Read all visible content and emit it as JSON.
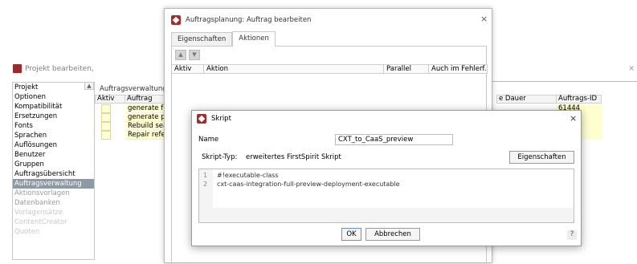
{
  "background_window": {
    "title": "Projekt bearbeiten,",
    "close_glyph": "×",
    "sidebar_items": [
      {
        "label": "Projekt",
        "active": false
      },
      {
        "label": "Optionen",
        "active": false
      },
      {
        "label": "Kompatibilität",
        "active": false
      },
      {
        "label": "Ersetzungen",
        "active": false
      },
      {
        "label": "Fonts",
        "active": false
      },
      {
        "label": "Sprachen",
        "active": false
      },
      {
        "label": "Auflösungen",
        "active": false
      },
      {
        "label": "Benutzer",
        "active": false
      },
      {
        "label": "Gruppen",
        "active": false
      },
      {
        "label": "Auftragsübersicht",
        "active": false
      },
      {
        "label": "Auftragsverwaltung",
        "active": true
      },
      {
        "label": "Aktionsvorlagen",
        "active": false
      },
      {
        "label": "Datenbanken",
        "active": false
      },
      {
        "label": "Vorlagensätze",
        "active": false
      },
      {
        "label": "ContentCreator",
        "active": false
      },
      {
        "label": "Quoten",
        "active": false
      }
    ],
    "panel_title": "Auftragsverwaltung",
    "table_headers": {
      "aktiv": "Aktiv",
      "auftrag": "Auftrag"
    },
    "table_rows": [
      "generate full",
      "generate pa",
      "Rebuild sea",
      "Repair refer"
    ],
    "right_headers": {
      "dauer": "e Dauer",
      "id": "Auftrags-ID"
    },
    "right_ids": [
      "61444",
      "",
      "",
      ""
    ]
  },
  "plan_dialog": {
    "title": "Auftragsplanung: Auftrag bearbeiten",
    "close_glyph": "×",
    "tabs": [
      {
        "label": "Eigenschaften",
        "active": false
      },
      {
        "label": "Aktionen",
        "active": true
      }
    ],
    "actions_header": {
      "aktiv": "Aktiv",
      "aktion": "Aktion",
      "parallel": "Parallel",
      "auch_im_fehlerfall": "Auch im Fehlerf..."
    }
  },
  "script_dialog": {
    "title": "Skript",
    "close_glyph": "×",
    "name_label": "Name",
    "name_value": "CXT_to_CaaS_preview",
    "type_label": "Skript-Typ:",
    "type_value": "erweitertes FirstSpirit Skript",
    "properties_button": "Eigenschaften",
    "code_lines": [
      {
        "n": "1",
        "text": "#!executable-class"
      },
      {
        "n": "2",
        "text": "cxt-caas-integration-full-preview-deployment-executable"
      }
    ],
    "ok_button": "OK",
    "cancel_button": "Abbrechen",
    "help_glyph": "?"
  },
  "colors": {
    "brand_icon": "#a12d2d",
    "active_nav": "#8d9aa6",
    "row_highlight": "#ffffd0"
  }
}
